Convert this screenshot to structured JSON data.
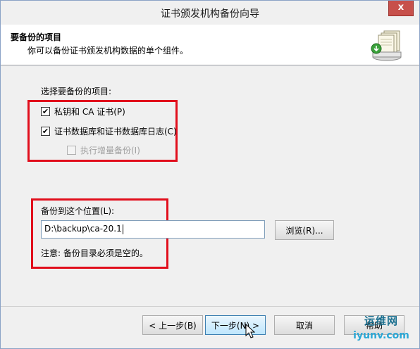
{
  "window": {
    "title": "证书颁发机构备份向导",
    "close_glyph": "x"
  },
  "header": {
    "title": "要备份的项目",
    "subtitle": "你可以备份证书颁发机构数据的单个组件。",
    "icon": "backup-wizard-icon"
  },
  "body": {
    "items_label": "选择要备份的项目:",
    "options": [
      {
        "label": "私钥和 CA 证书(P)",
        "checked": true,
        "enabled": true
      },
      {
        "label": "证书数据库和证书数据库日志(C)",
        "checked": true,
        "enabled": true
      },
      {
        "label": "执行增量备份(I)",
        "checked": false,
        "enabled": false
      }
    ],
    "location_label": "备份到这个位置(L):",
    "location_value": "D:\\backup\\ca-20.1",
    "browse_label": "浏览(R)...",
    "note": "注意: 备份目录必须是空的。"
  },
  "footer": {
    "back_label": "< 上一步(B)",
    "next_label": "下一步(N) >",
    "cancel_label": "取消",
    "help_label": "帮助"
  },
  "watermark": {
    "line1": "运维网",
    "line2": "iyunv.com"
  },
  "colors": {
    "highlight_box": "#e10e1c",
    "close_button": "#c7504b",
    "window_border": "#8aa2c6"
  }
}
